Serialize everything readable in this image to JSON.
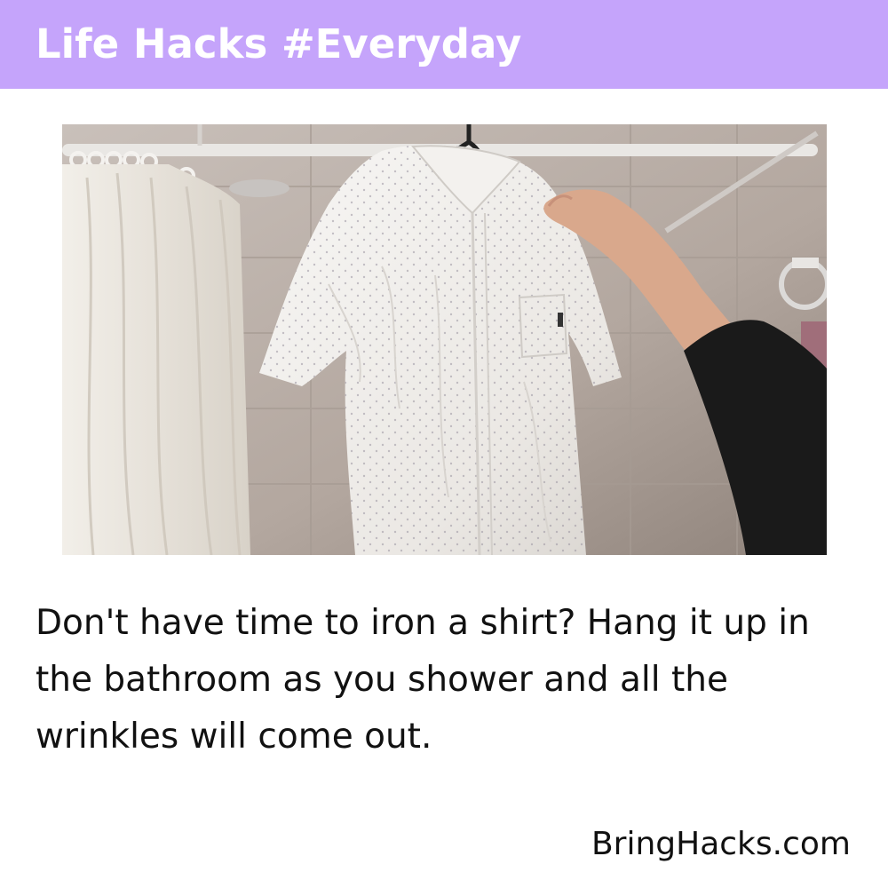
{
  "header": {
    "title": "Life Hacks #Everyday",
    "background_color": "#c5a4fb"
  },
  "photo": {
    "subject": "shirt-hanging-in-bathroom"
  },
  "caption": {
    "text": "Don't have time to iron a shirt? Hang it up in the bathroom as you shower and all the wrinkles will come out."
  },
  "footer": {
    "site": "BringHacks.com"
  }
}
